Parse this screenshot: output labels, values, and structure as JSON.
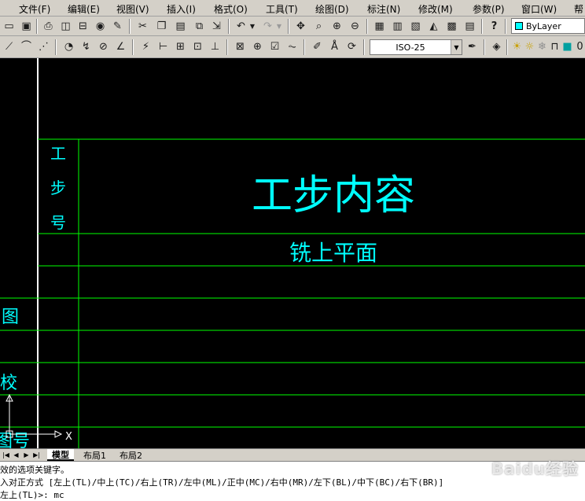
{
  "menu": {
    "items": [
      "文件(F)",
      "编辑(E)",
      "视图(V)",
      "插入(I)",
      "格式(O)",
      "工具(T)",
      "绘图(D)",
      "标注(N)",
      "修改(M)",
      "参数(P)",
      "窗口(W)",
      "帮"
    ]
  },
  "toolbar": {
    "layer_dropdown": "ByLayer",
    "dimstyle_dropdown": "ISO-25",
    "layer_color": "#00ffff"
  },
  "drawing": {
    "line_color": "#00ff00",
    "text_color": "#00ffff",
    "border_color": "#ffffff",
    "step_no_chars": [
      "工",
      "步",
      "号"
    ],
    "step_content_header": "工步内容",
    "step_content_value": "铣上平面",
    "left_label_1": "图",
    "left_label_2": "校",
    "left_label_3": "图号",
    "ucs_x_label": "X"
  },
  "tabs": {
    "model": "模型",
    "layout1": "布局1",
    "layout2": "布局2"
  },
  "command": {
    "line1": "效的选项关键字。",
    "line2": "入对正方式 [左上(TL)/中上(TC)/右上(TR)/左中(ML)/正中(MC)/右中(MR)/左下(BL)/中下(BC)/右下(BR)]",
    "line3": "左上(TL)>: mc"
  },
  "watermark": "Baidu经验"
}
